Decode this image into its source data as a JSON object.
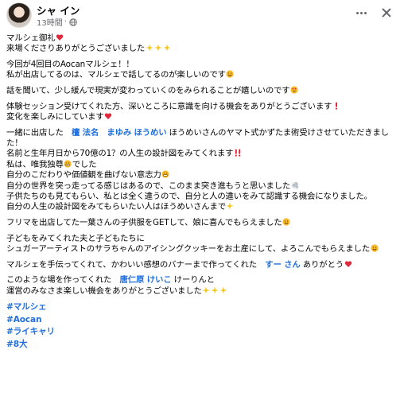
{
  "post": {
    "author": "シャ イン",
    "timestamp": "13時間",
    "colors": {
      "mention": "#216fdb",
      "meta": "#65676b",
      "text": "#050505"
    }
  },
  "content": {
    "p1": {
      "l1": "マルシェ御礼",
      "l2": "来場くださりありがとうございました"
    },
    "p2": {
      "l1": "今回が4回目のAocanマルシェ！！",
      "l2": "私が出店してるのは、マルシェで話してるのが楽しいのです"
    },
    "p3": {
      "l1": "話を聞いて、少し緩んで現実が変わっていくのをみられることが嬉しいのです"
    },
    "p4": {
      "l1": "体験セッション受けてくれた方、深いところに意識を向ける機会をありがとうございます",
      "l2": "変化を楽しみにしています"
    },
    "p5": {
      "l1a": "一緒に出店した　",
      "mention1": "檀 法名　まゆみ ほうめい",
      "l1b": " ほうめいさんのヤマト式かずたま術受けさせていただきました！",
      "l2": "名前と生年月日から70億の1？の人生の設計図をみてくれます",
      "l3": "私は、唯我独尊",
      "l3b": "でした",
      "l4": "自分のこだわりや価値観を曲げない意志力",
      "l5": "自分の世界を突っ走ってる感じはあるので、このまま突き進もうと思いました",
      "l6": "子供たちのも見てもらい、私とは全く違うので、自分と人の違いをみて認識する機会になりました。",
      "l7": "自分の人生の設計図をみてもらいたい人はほうめいさんまで"
    },
    "p6": {
      "l1": "フリマを出店してた一葉さんの子供服をGETして、娘に喜んでもらえました"
    },
    "p7": {
      "l1": "子どもをみてくれた夫と子どもたちに",
      "l2": "シュガーアーティストのサラちゃんのアイシングクッキーをお土産にして、よろこんでもらえました"
    },
    "p8": {
      "l1a": "マルシェを手伝ってくれて、かわいい感想のバナーまで作ってくれた　",
      "mention": "すー さん",
      "l1b": " ありがとう"
    },
    "p9": {
      "l1a": "このような場を作ってくれた　",
      "mention": "唐仁原 けいこ",
      "l1b": " けーりんと",
      "l2": "運営のみなさま楽しい機会をありがとうございました"
    },
    "hashtags": [
      "#マルシェ",
      "#Aocan",
      "#ライキャリ",
      "#8大"
    ]
  }
}
